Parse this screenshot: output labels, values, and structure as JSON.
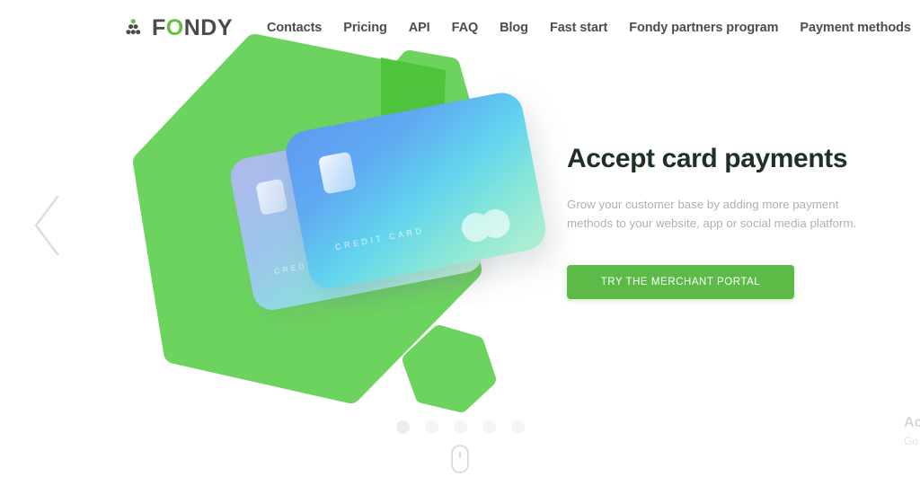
{
  "brand": {
    "logo_text_part1": "F",
    "logo_text_green": "O",
    "logo_text_part2": "NDY",
    "logo_icon": "hexagon-pyramid-icon",
    "accent_green": "#62c043",
    "shape_green": "#6cd45e",
    "shape_green_dark": "#4dc33a",
    "button_green": "#5cba46",
    "heading_color": "#1f3024",
    "subtext_color": "#aeb1ae"
  },
  "nav": {
    "items": [
      {
        "label": "Contacts"
      },
      {
        "label": "Pricing"
      },
      {
        "label": "API"
      },
      {
        "label": "FAQ"
      },
      {
        "label": "Blog"
      },
      {
        "label": "Fast start"
      },
      {
        "label": "Fondy partners program"
      },
      {
        "label": "Payment methods"
      }
    ]
  },
  "hero": {
    "title": "Accept card payments",
    "subtitle": "Grow your customer base by adding more payment methods to your website, app or social media platform.",
    "cta_label": "TRY THE MERCHANT PORTAL",
    "card_front_label": "C R E D I T   C A R D",
    "card_back_label": "C R E D I T   C A R D"
  },
  "next_slide_peek": {
    "title": "Ac",
    "subtitle": "Go"
  },
  "carousel": {
    "prev_arrow_icon": "chevron-left-icon",
    "active_index": 0,
    "dots": [
      {
        "id": "1"
      },
      {
        "id": "2"
      },
      {
        "id": "3"
      },
      {
        "id": "4"
      },
      {
        "id": "5"
      }
    ],
    "scroll_hint_icon": "mouse-scroll-icon"
  }
}
